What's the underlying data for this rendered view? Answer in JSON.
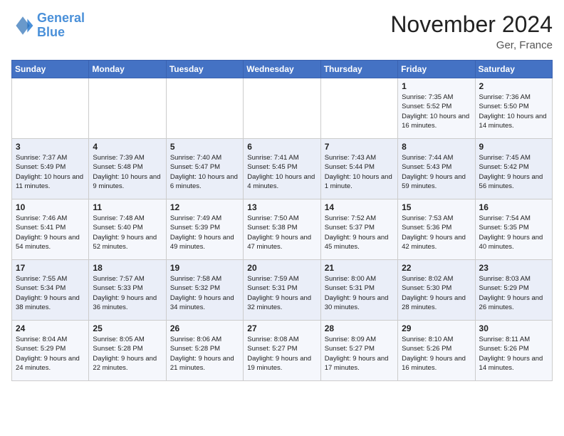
{
  "logo": {
    "line1": "General",
    "line2": "Blue"
  },
  "title": "November 2024",
  "location": "Ger, France",
  "days_of_week": [
    "Sunday",
    "Monday",
    "Tuesday",
    "Wednesday",
    "Thursday",
    "Friday",
    "Saturday"
  ],
  "weeks": [
    [
      {
        "day": "",
        "info": ""
      },
      {
        "day": "",
        "info": ""
      },
      {
        "day": "",
        "info": ""
      },
      {
        "day": "",
        "info": ""
      },
      {
        "day": "",
        "info": ""
      },
      {
        "day": "1",
        "info": "Sunrise: 7:35 AM\nSunset: 5:52 PM\nDaylight: 10 hours and 16 minutes."
      },
      {
        "day": "2",
        "info": "Sunrise: 7:36 AM\nSunset: 5:50 PM\nDaylight: 10 hours and 14 minutes."
      }
    ],
    [
      {
        "day": "3",
        "info": "Sunrise: 7:37 AM\nSunset: 5:49 PM\nDaylight: 10 hours and 11 minutes."
      },
      {
        "day": "4",
        "info": "Sunrise: 7:39 AM\nSunset: 5:48 PM\nDaylight: 10 hours and 9 minutes."
      },
      {
        "day": "5",
        "info": "Sunrise: 7:40 AM\nSunset: 5:47 PM\nDaylight: 10 hours and 6 minutes."
      },
      {
        "day": "6",
        "info": "Sunrise: 7:41 AM\nSunset: 5:45 PM\nDaylight: 10 hours and 4 minutes."
      },
      {
        "day": "7",
        "info": "Sunrise: 7:43 AM\nSunset: 5:44 PM\nDaylight: 10 hours and 1 minute."
      },
      {
        "day": "8",
        "info": "Sunrise: 7:44 AM\nSunset: 5:43 PM\nDaylight: 9 hours and 59 minutes."
      },
      {
        "day": "9",
        "info": "Sunrise: 7:45 AM\nSunset: 5:42 PM\nDaylight: 9 hours and 56 minutes."
      }
    ],
    [
      {
        "day": "10",
        "info": "Sunrise: 7:46 AM\nSunset: 5:41 PM\nDaylight: 9 hours and 54 minutes."
      },
      {
        "day": "11",
        "info": "Sunrise: 7:48 AM\nSunset: 5:40 PM\nDaylight: 9 hours and 52 minutes."
      },
      {
        "day": "12",
        "info": "Sunrise: 7:49 AM\nSunset: 5:39 PM\nDaylight: 9 hours and 49 minutes."
      },
      {
        "day": "13",
        "info": "Sunrise: 7:50 AM\nSunset: 5:38 PM\nDaylight: 9 hours and 47 minutes."
      },
      {
        "day": "14",
        "info": "Sunrise: 7:52 AM\nSunset: 5:37 PM\nDaylight: 9 hours and 45 minutes."
      },
      {
        "day": "15",
        "info": "Sunrise: 7:53 AM\nSunset: 5:36 PM\nDaylight: 9 hours and 42 minutes."
      },
      {
        "day": "16",
        "info": "Sunrise: 7:54 AM\nSunset: 5:35 PM\nDaylight: 9 hours and 40 minutes."
      }
    ],
    [
      {
        "day": "17",
        "info": "Sunrise: 7:55 AM\nSunset: 5:34 PM\nDaylight: 9 hours and 38 minutes."
      },
      {
        "day": "18",
        "info": "Sunrise: 7:57 AM\nSunset: 5:33 PM\nDaylight: 9 hours and 36 minutes."
      },
      {
        "day": "19",
        "info": "Sunrise: 7:58 AM\nSunset: 5:32 PM\nDaylight: 9 hours and 34 minutes."
      },
      {
        "day": "20",
        "info": "Sunrise: 7:59 AM\nSunset: 5:31 PM\nDaylight: 9 hours and 32 minutes."
      },
      {
        "day": "21",
        "info": "Sunrise: 8:00 AM\nSunset: 5:31 PM\nDaylight: 9 hours and 30 minutes."
      },
      {
        "day": "22",
        "info": "Sunrise: 8:02 AM\nSunset: 5:30 PM\nDaylight: 9 hours and 28 minutes."
      },
      {
        "day": "23",
        "info": "Sunrise: 8:03 AM\nSunset: 5:29 PM\nDaylight: 9 hours and 26 minutes."
      }
    ],
    [
      {
        "day": "24",
        "info": "Sunrise: 8:04 AM\nSunset: 5:29 PM\nDaylight: 9 hours and 24 minutes."
      },
      {
        "day": "25",
        "info": "Sunrise: 8:05 AM\nSunset: 5:28 PM\nDaylight: 9 hours and 22 minutes."
      },
      {
        "day": "26",
        "info": "Sunrise: 8:06 AM\nSunset: 5:28 PM\nDaylight: 9 hours and 21 minutes."
      },
      {
        "day": "27",
        "info": "Sunrise: 8:08 AM\nSunset: 5:27 PM\nDaylight: 9 hours and 19 minutes."
      },
      {
        "day": "28",
        "info": "Sunrise: 8:09 AM\nSunset: 5:27 PM\nDaylight: 9 hours and 17 minutes."
      },
      {
        "day": "29",
        "info": "Sunrise: 8:10 AM\nSunset: 5:26 PM\nDaylight: 9 hours and 16 minutes."
      },
      {
        "day": "30",
        "info": "Sunrise: 8:11 AM\nSunset: 5:26 PM\nDaylight: 9 hours and 14 minutes."
      }
    ]
  ]
}
